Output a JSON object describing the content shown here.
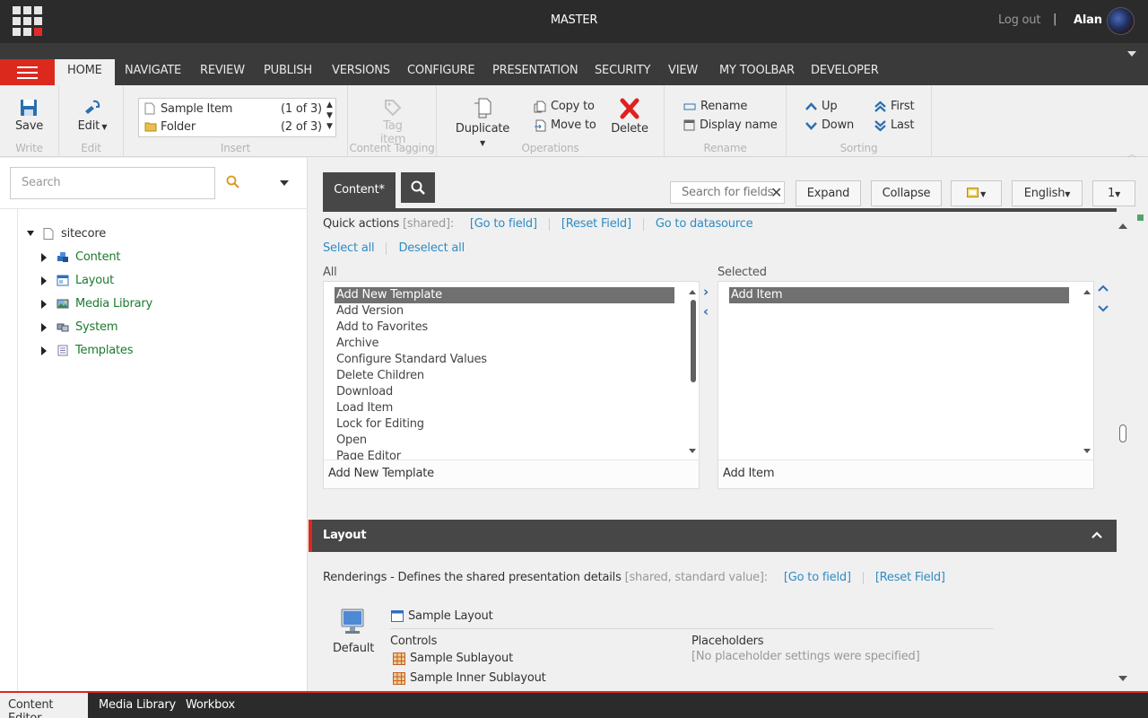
{
  "topbar": {
    "title": "MASTER",
    "logout": "Log out",
    "separator": "|",
    "user": "Alan"
  },
  "tabs": [
    "HOME",
    "NAVIGATE",
    "REVIEW",
    "PUBLISH",
    "VERSIONS",
    "CONFIGURE",
    "PRESENTATION",
    "SECURITY",
    "VIEW",
    "MY TOOLBAR",
    "DEVELOPER"
  ],
  "ribbon": {
    "write": {
      "label": "Write",
      "save": "Save"
    },
    "edit": {
      "label": "Edit",
      "edit": "Edit"
    },
    "insert": {
      "label": "Insert",
      "items": [
        {
          "name": "Sample Item",
          "count": "(1 of 3)"
        },
        {
          "name": "Folder",
          "count": "(2 of 3)"
        }
      ]
    },
    "tagging": {
      "label": "Content Tagging",
      "tag_item": "Tag item"
    },
    "operations": {
      "label": "Operations",
      "duplicate": "Duplicate",
      "copy_to": "Copy to",
      "move_to": "Move to",
      "delete": "Delete"
    },
    "rename": {
      "label": "Rename",
      "rename": "Rename",
      "display_name": "Display name"
    },
    "sorting": {
      "label": "Sorting",
      "up": "Up",
      "down": "Down",
      "first": "First",
      "last": "Last"
    }
  },
  "left": {
    "search_placeholder": "Search",
    "tree": {
      "root": "sitecore",
      "children": [
        "Content",
        "Layout",
        "Media Library",
        "System",
        "Templates"
      ]
    }
  },
  "editor": {
    "tab": "Content*",
    "field_search_placeholder": "Search for fields",
    "expand": "Expand",
    "collapse": "Collapse",
    "language": "English",
    "version": "1",
    "quick_actions": {
      "label": "Quick actions",
      "shared": "[shared]:",
      "go_to_field": "[Go to field]",
      "reset_field": "[Reset Field]",
      "go_to_datasource": "Go to datasource"
    },
    "select_all": "Select all",
    "deselect_all": "Deselect all",
    "all_label": "All",
    "selected_label": "Selected",
    "all_items": [
      "Add New Template",
      "Add Version",
      "Add to Favorites",
      "Archive",
      "Configure Standard Values",
      "Delete Children",
      "Download",
      "Load Item",
      "Lock for Editing",
      "Open",
      "Page Editor"
    ],
    "all_footer": "Add New Template",
    "selected_items": [
      "Add Item"
    ],
    "selected_footer": "Add Item",
    "layout_section": "Layout",
    "renderings": {
      "label": "Renderings - Defines the shared presentation details",
      "meta": "[shared, standard value]:",
      "go_to_field": "[Go to field]",
      "reset_field": "[Reset Field]",
      "device": "Default",
      "layout_name": "Sample Layout",
      "controls_header": "Controls",
      "controls": [
        "Sample Sublayout",
        "Sample Inner Sublayout"
      ],
      "placeholders_header": "Placeholders",
      "placeholders_none": "[No placeholder settings were specified]"
    }
  },
  "bottom_tabs": [
    "Content Editor",
    "Media Library",
    "Workbox"
  ],
  "colors": {
    "accent_red": "#dc291e",
    "link": "#2f8bc4",
    "tree_green": "#1b7b2c"
  }
}
